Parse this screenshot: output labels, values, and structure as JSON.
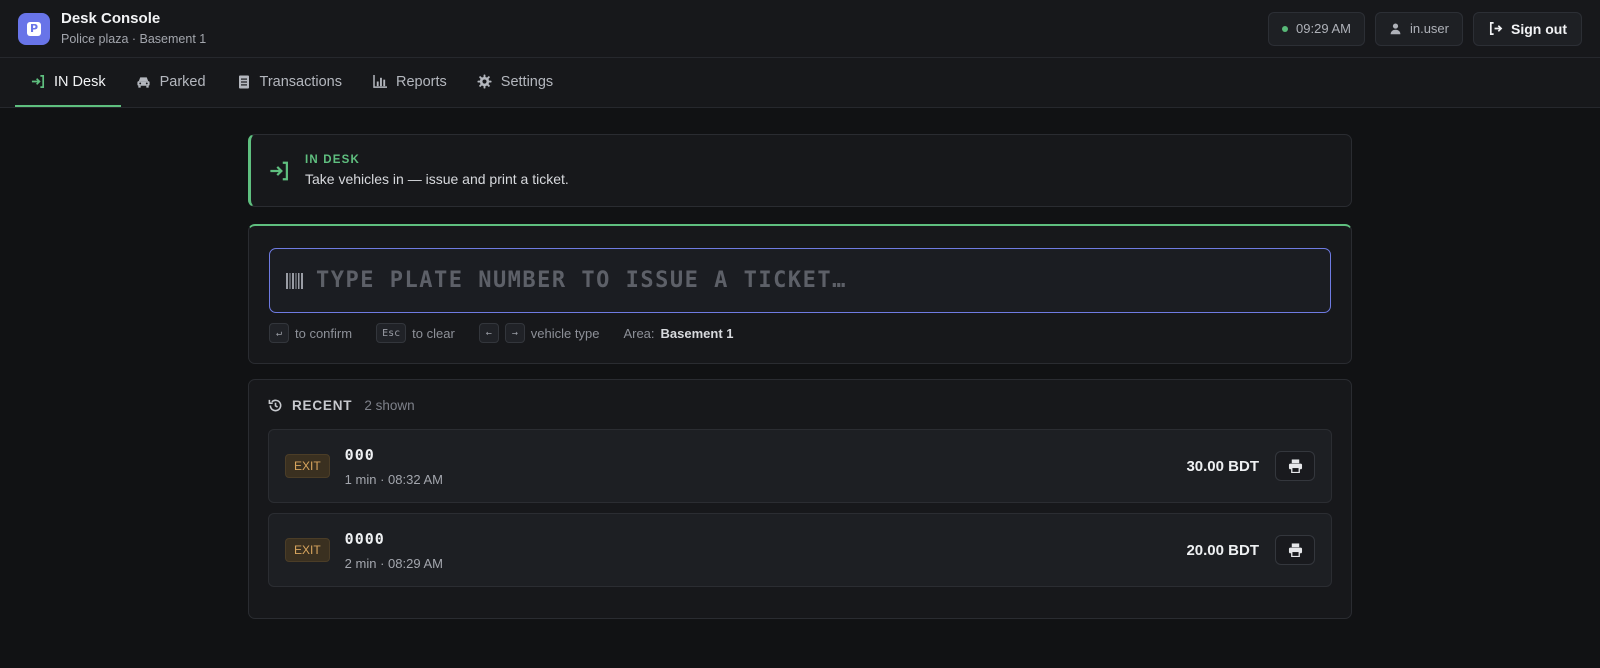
{
  "app": {
    "title": "Desk Console",
    "subtitle": "Police plaza · Basement 1",
    "logo_letter": "P",
    "accent_color": "#6874e8"
  },
  "header": {
    "time": "09:29 AM",
    "user": "in.user",
    "sign_out_label": "Sign out",
    "status_color": "#58b978"
  },
  "nav": {
    "tabs": [
      {
        "label": "IN Desk",
        "icon": "sign-in-icon",
        "active": true
      },
      {
        "label": "Parked",
        "icon": "car-icon",
        "active": false
      },
      {
        "label": "Transactions",
        "icon": "receipt-icon",
        "active": false
      },
      {
        "label": "Reports",
        "icon": "chart-icon",
        "active": false
      },
      {
        "label": "Settings",
        "icon": "gear-icon",
        "active": false
      }
    ]
  },
  "hero": {
    "label": "IN DESK",
    "description": "Take vehicles in — issue and print a ticket.",
    "accent_color": "#5fbf7f"
  },
  "entry": {
    "placeholder": "TYPE PLATE NUMBER TO ISSUE A TICKET…",
    "value": "",
    "hints": {
      "confirm_key": "↵",
      "confirm_label": "to confirm",
      "clear_key": "Esc",
      "clear_label": "to clear",
      "left_key": "←",
      "right_key": "→",
      "vehicle_type_label": "vehicle type",
      "area_label": "Area:",
      "area_value": "Basement 1"
    }
  },
  "recent": {
    "title": "RECENT",
    "count_text": "2 shown",
    "items": [
      {
        "badge": "EXIT",
        "plate": "000",
        "meta": "1 min · 08:32 AM",
        "amount": "30.00 BDT"
      },
      {
        "badge": "EXIT",
        "plate": "0000",
        "meta": "2 min · 08:29 AM",
        "amount": "20.00 BDT"
      }
    ]
  }
}
